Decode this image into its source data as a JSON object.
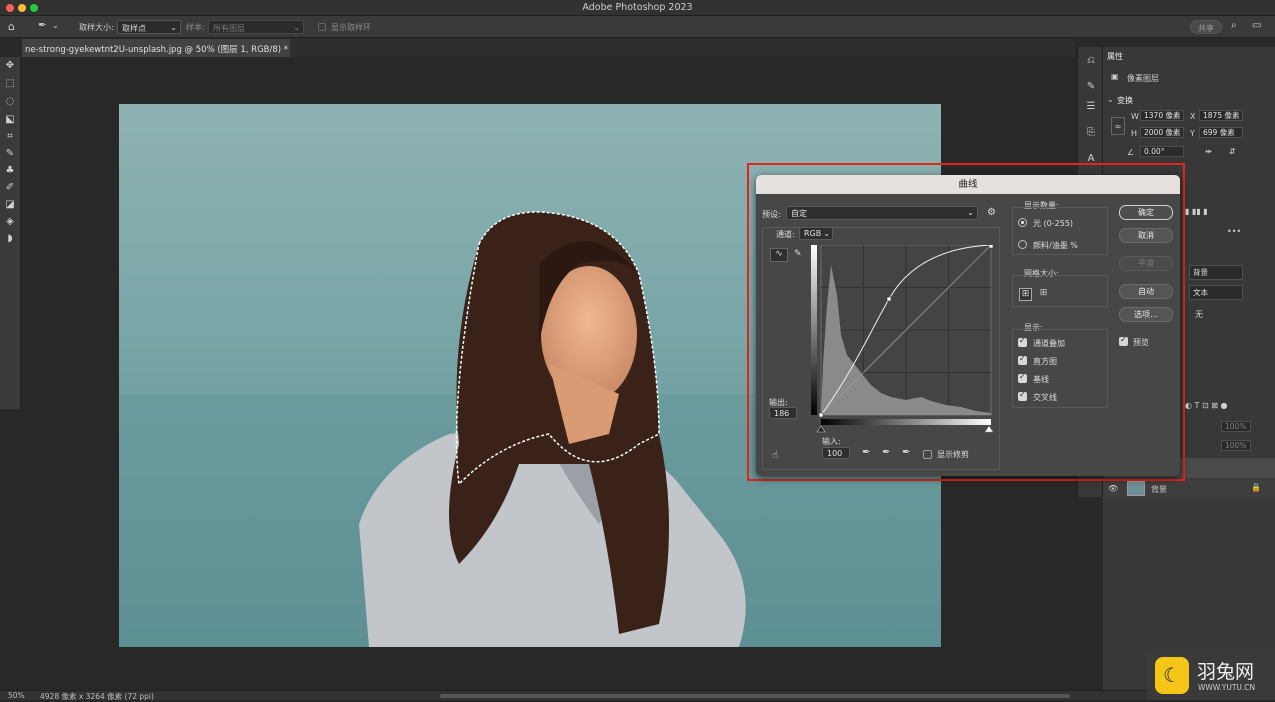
{
  "app": {
    "title": "Adobe Photoshop 2023",
    "share_label": "共享"
  },
  "options_bar": {
    "sample_size_label": "取样大小:",
    "sample_size_value": "取样点",
    "sample_label": "样本:",
    "sample_value": "所有图层",
    "show_ring_label": "显示取样环"
  },
  "document": {
    "tab_title": "ne-strong-gyekewtnt2U-unsplash.jpg @ 50% (图层 1, RGB/8) *"
  },
  "status": {
    "zoom": "50%",
    "doc_info": "4928 像素 x 3264 像素 (72 ppi)"
  },
  "colors": {
    "foreground": "#5a9ec3",
    "background": "#111111",
    "highlight": "#e1261c"
  },
  "properties": {
    "tab_label": "属性",
    "layer_type": "像素图层",
    "transform_label": "变换",
    "w_label": "W",
    "w_value": "1370 像素",
    "x_label": "X",
    "x_value": "1875 像素",
    "h_label": "H",
    "h_value": "2000 像素",
    "y_label": "Y",
    "y_value": "699 像素",
    "angle_value": "0.00°",
    "partial_1": "背景",
    "partial_2": "文本",
    "partial_3": "无",
    "opacity_value": "100%",
    "fill_value": "100%",
    "layer_name": "背景"
  },
  "curves_dialog": {
    "title": "曲线",
    "preset_label": "预设:",
    "preset_value": "自定",
    "channel_label": "通道:",
    "channel_value": "RGB",
    "output_label": "输出:",
    "output_value": "186",
    "input_label": "输入:",
    "input_value": "100",
    "show_clipping_label": "显示修剪",
    "show_amount_label": "显示数量:",
    "light_option": "光 (0-255)",
    "pigment_option": "颜料/油墨 %",
    "grid_size_label": "网格大小:",
    "show_label": "显示:",
    "show_channel_overlay": "通道叠加",
    "show_histogram": "直方图",
    "show_baseline": "基线",
    "show_intersection": "交叉线",
    "buttons": {
      "ok": "确定",
      "cancel": "取消",
      "smooth": "平滑",
      "auto": "自动",
      "options": "选项..."
    },
    "preview_label": "预览"
  },
  "watermark": {
    "text": "羽兔网",
    "url": "WWW.YUTU.CN"
  }
}
